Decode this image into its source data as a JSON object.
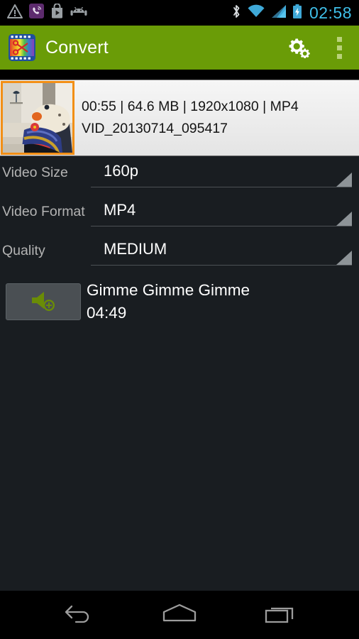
{
  "status_bar": {
    "icons": [
      "warning-triangle-icon",
      "viber-icon",
      "play-store-icon",
      "android-head-icon"
    ],
    "right_icons": [
      "bluetooth-icon",
      "wifi-icon",
      "cellular-signal-icon",
      "battery-charging-icon"
    ],
    "clock": "02:58",
    "clock_color": "#3fbfe8"
  },
  "action_bar": {
    "app_icon": "androvid-scissors-film-icon",
    "title": "Convert",
    "settings_icon": "gears-settings-icon",
    "overflow_icon": "overflow-menu-icon",
    "background_color": "#6a9c07"
  },
  "video_info": {
    "thumbnail": "video-thumbnail",
    "thumbnail_border_color": "#f28f16",
    "details": "00:55 | 64.6 MB | 1920x1080 | MP4",
    "filename": "VID_20130714_095417"
  },
  "settings": {
    "rows": [
      {
        "label": "Video Size",
        "value": "160p",
        "name": "video-size"
      },
      {
        "label": "Video Format",
        "value": "MP4",
        "name": "video-format"
      },
      {
        "label": "Quality",
        "value": "MEDIUM",
        "name": "quality"
      }
    ]
  },
  "audio_track": {
    "add_icon": "speaker-add-icon",
    "icon_color": "#6a8c06",
    "title": "Gimme Gimme Gimme",
    "duration": "04:49"
  },
  "nav_bar": {
    "back": "back-icon",
    "home": "home-icon",
    "recents": "recents-icon"
  }
}
